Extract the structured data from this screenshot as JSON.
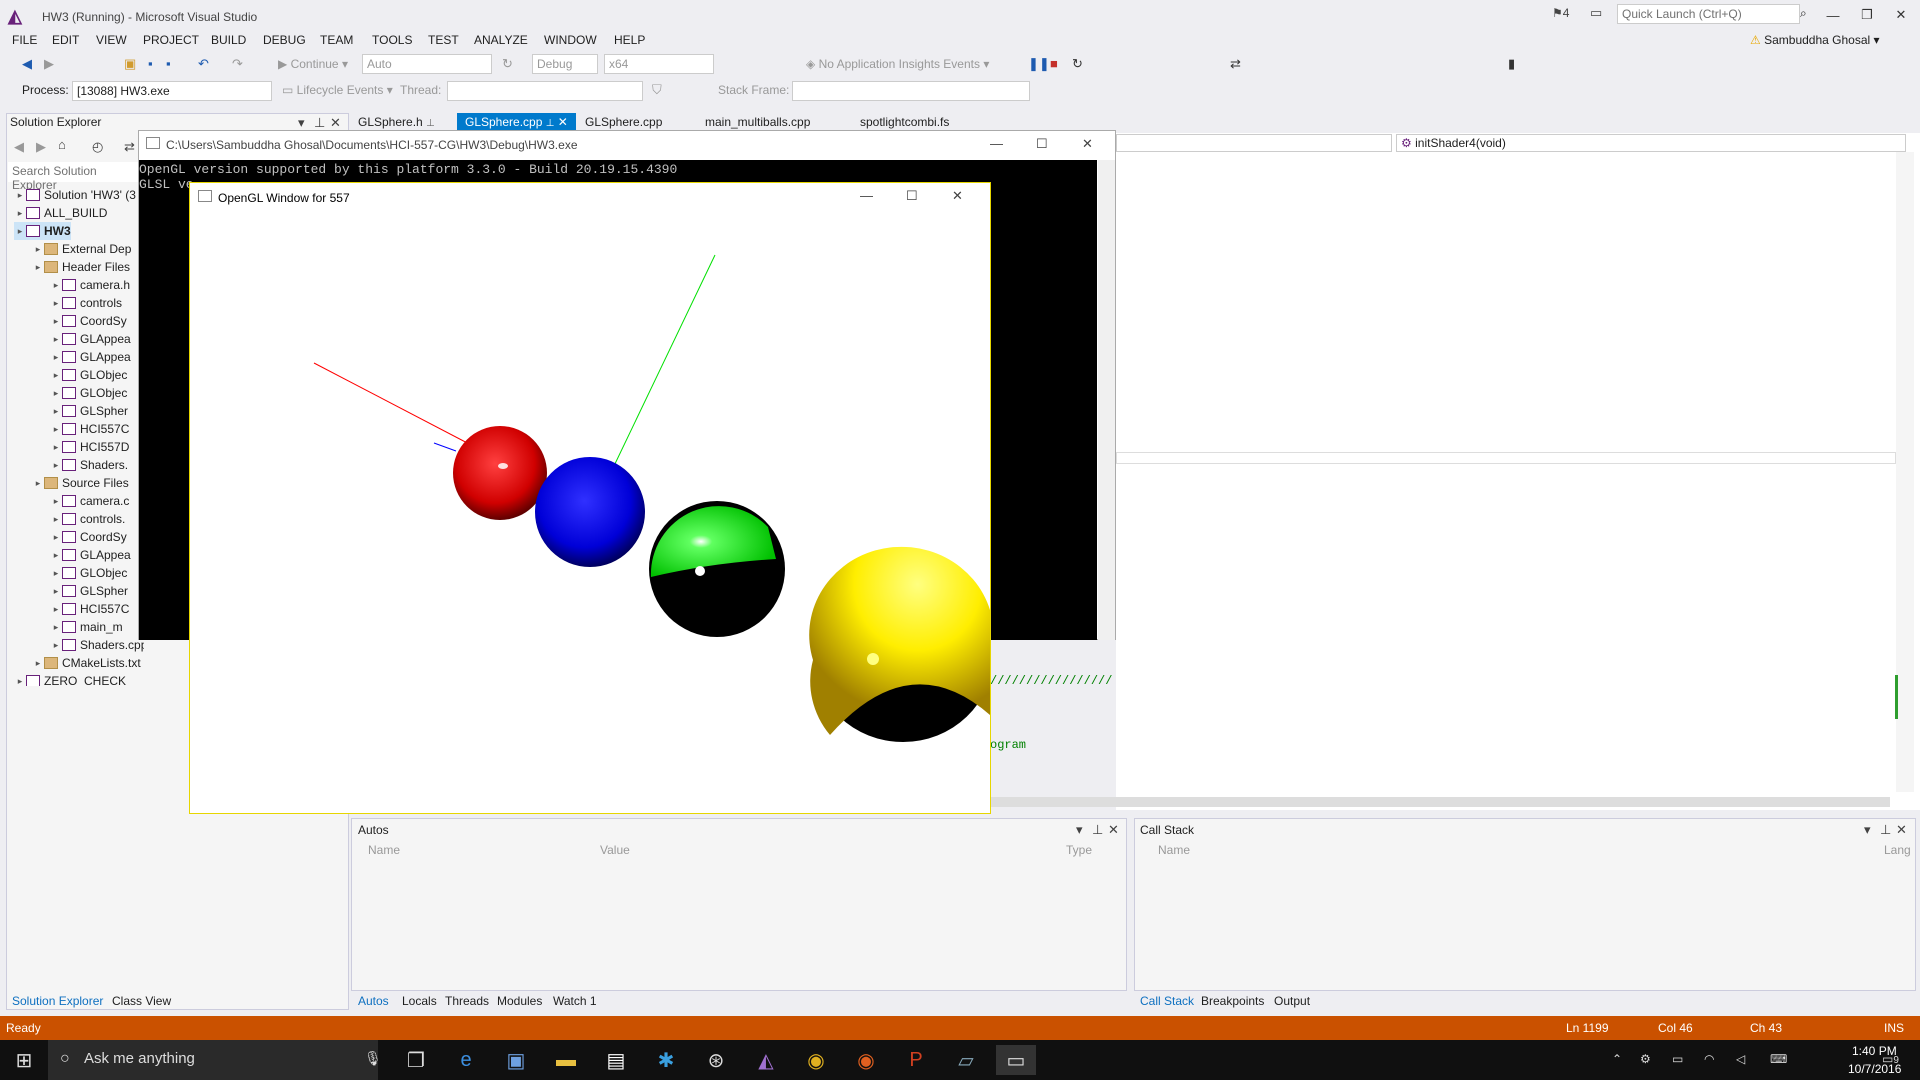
{
  "window": {
    "title": "HW3 (Running) - Microsoft Visual Studio",
    "notifications": "4",
    "quick_launch_placeholder": "Quick Launch (Ctrl+Q)",
    "user": "Sambuddha Ghosal"
  },
  "menu": [
    "FILE",
    "EDIT",
    "VIEW",
    "PROJECT",
    "BUILD",
    "DEBUG",
    "TEAM",
    "TOOLS",
    "TEST",
    "ANALYZE",
    "WINDOW",
    "HELP"
  ],
  "toolbar": {
    "continue": "Continue",
    "auto": "Auto",
    "config": "Debug",
    "platform": "x64",
    "insights": "No Application Insights Events",
    "process_label": "Process:",
    "process_value": "[13088] HW3.exe",
    "lifecycle": "Lifecycle Events",
    "thread_label": "Thread:",
    "stackframe_label": "Stack Frame:"
  },
  "solution_explorer": {
    "title": "Solution Explorer",
    "search_placeholder": "Search Solution Explorer",
    "items": [
      {
        "label": "Solution 'HW3' (3 p",
        "depth": 0
      },
      {
        "label": "ALL_BUILD",
        "depth": 0
      },
      {
        "label": "HW3",
        "depth": 0
      },
      {
        "label": "External Dep",
        "depth": 1
      },
      {
        "label": "Header Files",
        "depth": 1
      },
      {
        "label": "camera.h",
        "depth": 2
      },
      {
        "label": "controls",
        "depth": 2
      },
      {
        "label": "CoordSy",
        "depth": 2
      },
      {
        "label": "GLAppea",
        "depth": 2
      },
      {
        "label": "GLAppea",
        "depth": 2
      },
      {
        "label": "GLObjec",
        "depth": 2
      },
      {
        "label": "GLObjec",
        "depth": 2
      },
      {
        "label": "GLSpher",
        "depth": 2
      },
      {
        "label": "HCI557C",
        "depth": 2
      },
      {
        "label": "HCI557D",
        "depth": 2
      },
      {
        "label": "Shaders.",
        "depth": 2
      },
      {
        "label": "Source Files",
        "depth": 1
      },
      {
        "label": "camera.c",
        "depth": 2
      },
      {
        "label": "controls.",
        "depth": 2
      },
      {
        "label": "CoordSy",
        "depth": 2
      },
      {
        "label": "GLAppea",
        "depth": 2
      },
      {
        "label": "GLObjec",
        "depth": 2
      },
      {
        "label": "GLSpher",
        "depth": 2
      },
      {
        "label": "HCI557C",
        "depth": 2
      },
      {
        "label": "main_m",
        "depth": 2
      },
      {
        "label": "Shaders.cpp",
        "depth": 2
      },
      {
        "label": "CMakeLists.txt",
        "depth": 1
      },
      {
        "label": "ZERO_CHECK",
        "depth": 0
      }
    ],
    "tabs": [
      "Solution Explorer",
      "Class View"
    ]
  },
  "doc_tabs": [
    "GLSphere.h",
    "GLSphere.cpp",
    "GLSphere.cpp",
    "main_multiballs.cpp",
    "spotlightcombi.fs"
  ],
  "editor": {
    "nav_function": "initShader4(void)",
    "code_line1": "/////////////////",
    "code_line2": "ogram"
  },
  "console": {
    "title": "C:\\Users\\Sambuddha Ghosal\\Documents\\HCI-557-CG\\HW3\\Debug\\HW3.exe",
    "line1": "OpenGL version supported by this platform 3.3.0 - Build 20.19.15.4390",
    "line2": "GLSL ve"
  },
  "glwindow": {
    "title": "OpenGL Window for 557"
  },
  "autos": {
    "title": "Autos",
    "columns": [
      "Name",
      "Value",
      "Type"
    ],
    "tabs": [
      "Autos",
      "Locals",
      "Threads",
      "Modules",
      "Watch 1"
    ]
  },
  "callstack": {
    "title": "Call Stack",
    "columns": [
      "Name",
      "Lang"
    ],
    "tabs": [
      "Call Stack",
      "Breakpoints",
      "Output"
    ]
  },
  "status": {
    "ready": "Ready",
    "ln": "Ln 1199",
    "col": "Col 46",
    "ch": "Ch 43",
    "ins": "INS"
  },
  "taskbar": {
    "search_placeholder": "Ask me anything",
    "time": "1:40 PM",
    "date": "10/7/2016",
    "notif_count": "9"
  },
  "colors": {
    "status_bar": "#ca5100",
    "active_tab": "#007acc",
    "sphere_red": "#ff0000",
    "sphere_blue": "#0000ff",
    "sphere_green": "#00ff00",
    "sphere_yellow": "#ffff00"
  }
}
